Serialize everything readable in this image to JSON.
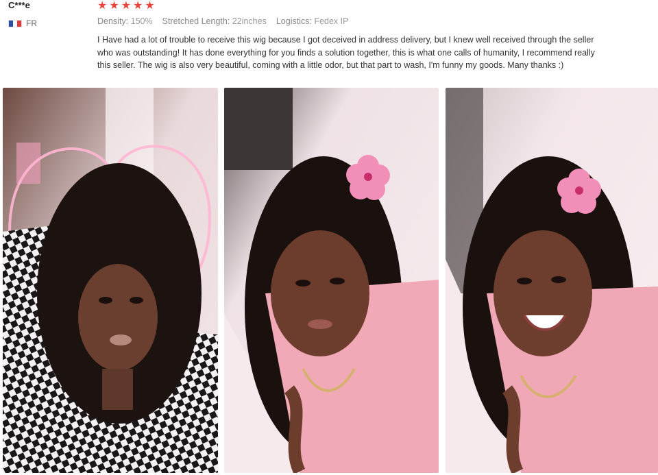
{
  "review": {
    "reviewer_name": "C***e",
    "country_code": "FR",
    "rating": 5,
    "stars": [
      "★",
      "★",
      "★",
      "★",
      "★"
    ],
    "star_color": "#e8473c",
    "attributes": [
      {
        "label": "Density:",
        "value": "150%"
      },
      {
        "label": "Stretched Length:",
        "value": "22inches"
      },
      {
        "label": "Logistics:",
        "value": "Fedex IP"
      }
    ],
    "text": "I Have had a lot of trouble to receive this wig because I got deceived in address delivery, but I knew well received through the seller who was outstanding! It has done everything for you finds a solution together, this is what one calls of humanity, I recommend really this seller. The wig is also very beautiful, coming with a little odor, but that part to wash, I'm funny my goods. Many thanks :)"
  },
  "photos": [
    {
      "icon": "selfie-photo-checkered-top"
    },
    {
      "icon": "selfie-photo-pink-flower"
    },
    {
      "icon": "selfie-photo-pink-flower-smile"
    }
  ]
}
